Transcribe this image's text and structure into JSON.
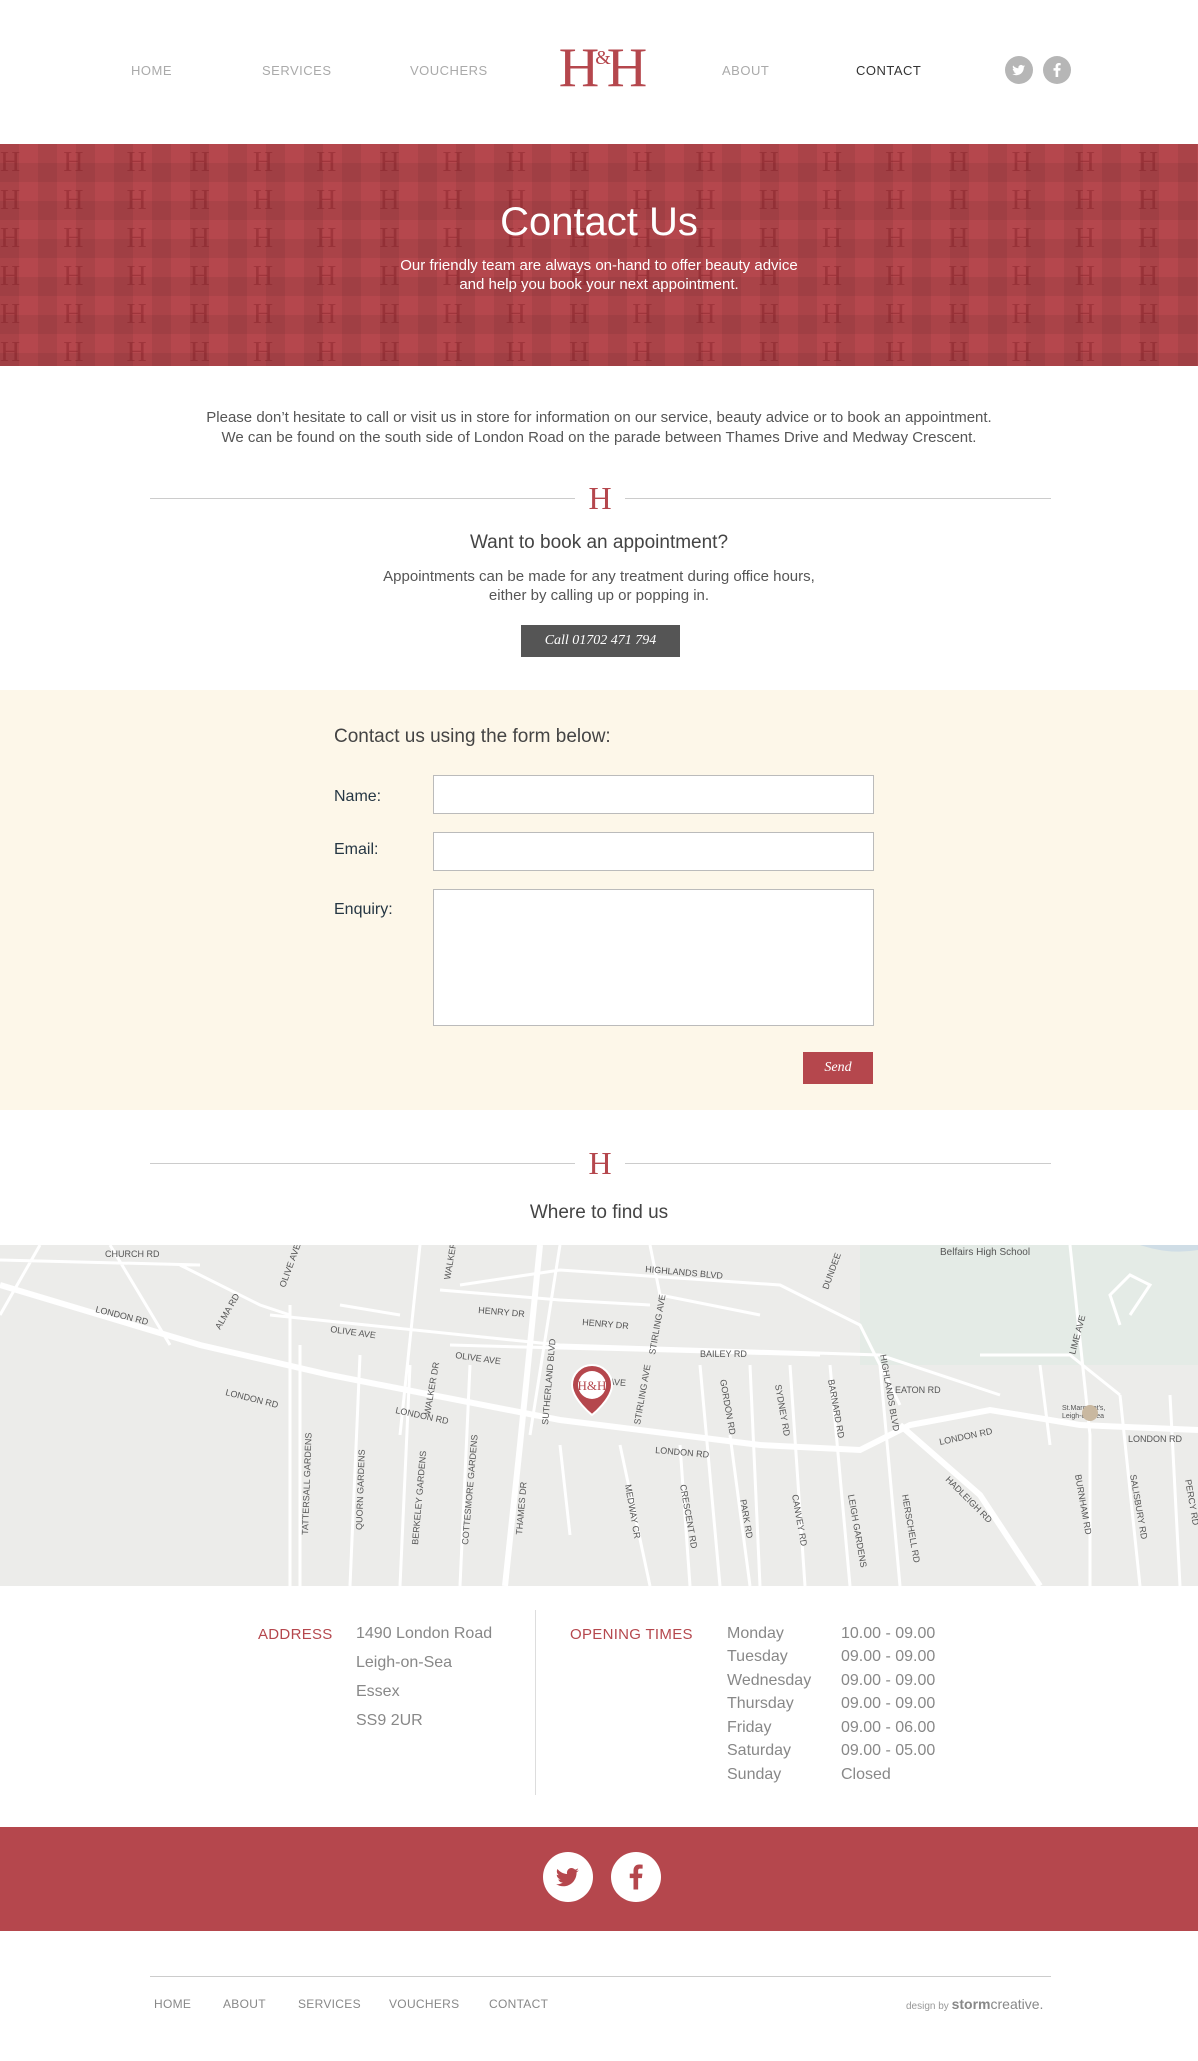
{
  "nav": {
    "home": "HOME",
    "services": "SERVICES",
    "vouchers": "VOUCHERS",
    "about": "ABOUT",
    "contact": "CONTACT",
    "logo_left": "H",
    "logo_amp": "&",
    "logo_right": "H",
    "social": [
      "twitter-icon",
      "facebook-icon"
    ]
  },
  "hero": {
    "title": "Contact Us",
    "subtitle_line1": "Our friendly team are always on-hand to offer beauty advice",
    "subtitle_line2": "and help you book your next appointment."
  },
  "intro": {
    "line1": "Please don’t hesitate to call or visit us in store for information on our service, beauty advice or to book an appointment.",
    "line2": "We can be found on the south side of London Road on the parade between Thames Drive and Medway Crescent."
  },
  "divider_mark": "H",
  "booking": {
    "title": "Want to book an appointment?",
    "text_line1": "Appointments can be made for any treatment during office hours,",
    "text_line2": "either by calling up or popping in.",
    "call_button": "Call 01702 471 794"
  },
  "form": {
    "title": "Contact us using the form below:",
    "name_label": "Name:",
    "email_label": "Email:",
    "enquiry_label": "Enquiry:",
    "name_value": "",
    "email_value": "",
    "enquiry_value": "",
    "send_button": "Send"
  },
  "find_us": {
    "title": "Where to find us"
  },
  "map": {
    "marker_label": "H&H",
    "places": [
      "Belfairs High School",
      "St.Margaret's,",
      "Leigh-on-Sea"
    ],
    "streets": [
      "CHURCH RD",
      "LONDON RD",
      "ALMA RD",
      "OLIVE AVE",
      "WALKER",
      "HENRY DR",
      "HIGHLANDS BLVD",
      "DUNDEE",
      "STIRLING AVE",
      "BAILEY RD",
      "WALKER DR",
      "SUTHERLAND BLVD",
      "GORDON RD",
      "SYDNEY RD",
      "BARNARD RD",
      "HIGHLANDS BLVD",
      "EATON RD",
      "LIME AVE",
      "TATTERSALL GARDENS",
      "QUORN GARDENS",
      "BERKELEY GARDENS",
      "COTTESMORE GARDENS",
      "THAMES DR",
      "MEDWAY CR",
      "CRESCENT RD",
      "PARK RD",
      "CANVEY RD",
      "LEIGH GARDENS",
      "HERSCHELL RD",
      "HADLEIGH RD",
      "BURNHAM RD",
      "SALISBURY RD",
      "PERCY RD"
    ]
  },
  "address": {
    "label": "ADDRESS",
    "lines": [
      "1490 London Road",
      "Leigh-on-Sea",
      "Essex",
      "SS9 2UR"
    ]
  },
  "opening": {
    "label": "OPENING TIMES",
    "rows": [
      {
        "day": "Monday",
        "hours": "10.00 - 09.00"
      },
      {
        "day": "Tuesday",
        "hours": "09.00 - 09.00"
      },
      {
        "day": "Wednesday",
        "hours": "09.00 - 09.00"
      },
      {
        "day": "Thursday",
        "hours": "09.00 - 09.00"
      },
      {
        "day": "Friday",
        "hours": "09.00 - 06.00"
      },
      {
        "day": "Saturday",
        "hours": "09.00 - 05.00"
      },
      {
        "day": "Sunday",
        "hours": "Closed"
      }
    ]
  },
  "footer": {
    "home": "HOME",
    "about": "ABOUT",
    "services": "SERVICES",
    "vouchers": "VOUCHERS",
    "contact": "CONTACT",
    "credit_prefix": "design by",
    "credit_bold": "storm",
    "credit_rest": "creative."
  },
  "colors": {
    "brand": "#b5474d",
    "cream": "#fdf7e9",
    "button_dark": "#555555"
  }
}
